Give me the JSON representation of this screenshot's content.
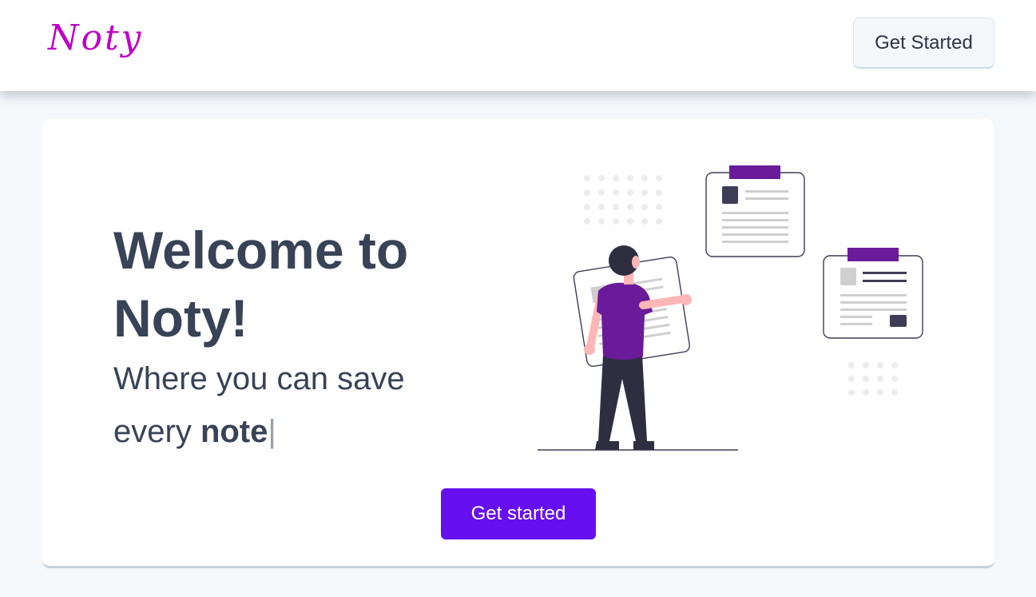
{
  "navbar": {
    "brand": "Noty",
    "cta_label": "Get Started"
  },
  "hero": {
    "title": "Welcome to Noty!",
    "subtitle_prefix": "Where you can save every",
    "subtitle_highlight": "note",
    "caret": "|",
    "cta_label": "Get started"
  },
  "colors": {
    "brand": "#c000c8",
    "accent": "#6610f2",
    "illustration_accent": "#6a1b9a",
    "text": "#394357",
    "page_background": "#f6f9fc"
  },
  "illustration": {
    "icon": "person-with-notes-illustration"
  }
}
